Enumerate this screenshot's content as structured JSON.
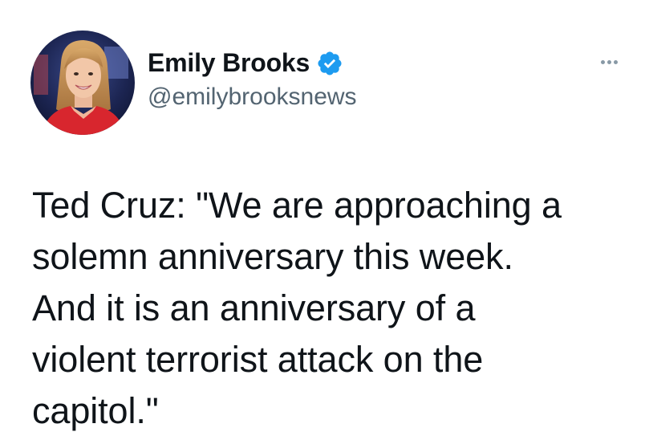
{
  "author": {
    "display_name": "Emily Brooks",
    "handle": "@emilybrooksnews",
    "verified": true,
    "avatar_icon": "profile-photo",
    "verified_icon": "verified-badge-icon",
    "verified_color": "#1d9bf0"
  },
  "menu": {
    "more_icon": "more-options-icon"
  },
  "tweet": {
    "text_lines": [
      "Ted Cruz: \"We are approaching a",
      "solemn anniversary this week.",
      "And it is an anniversary of a",
      "violent terrorist attack on the",
      "capitol.\""
    ]
  },
  "colors": {
    "text": "#0f1419",
    "secondary_text": "#536471",
    "background": "#ffffff"
  }
}
